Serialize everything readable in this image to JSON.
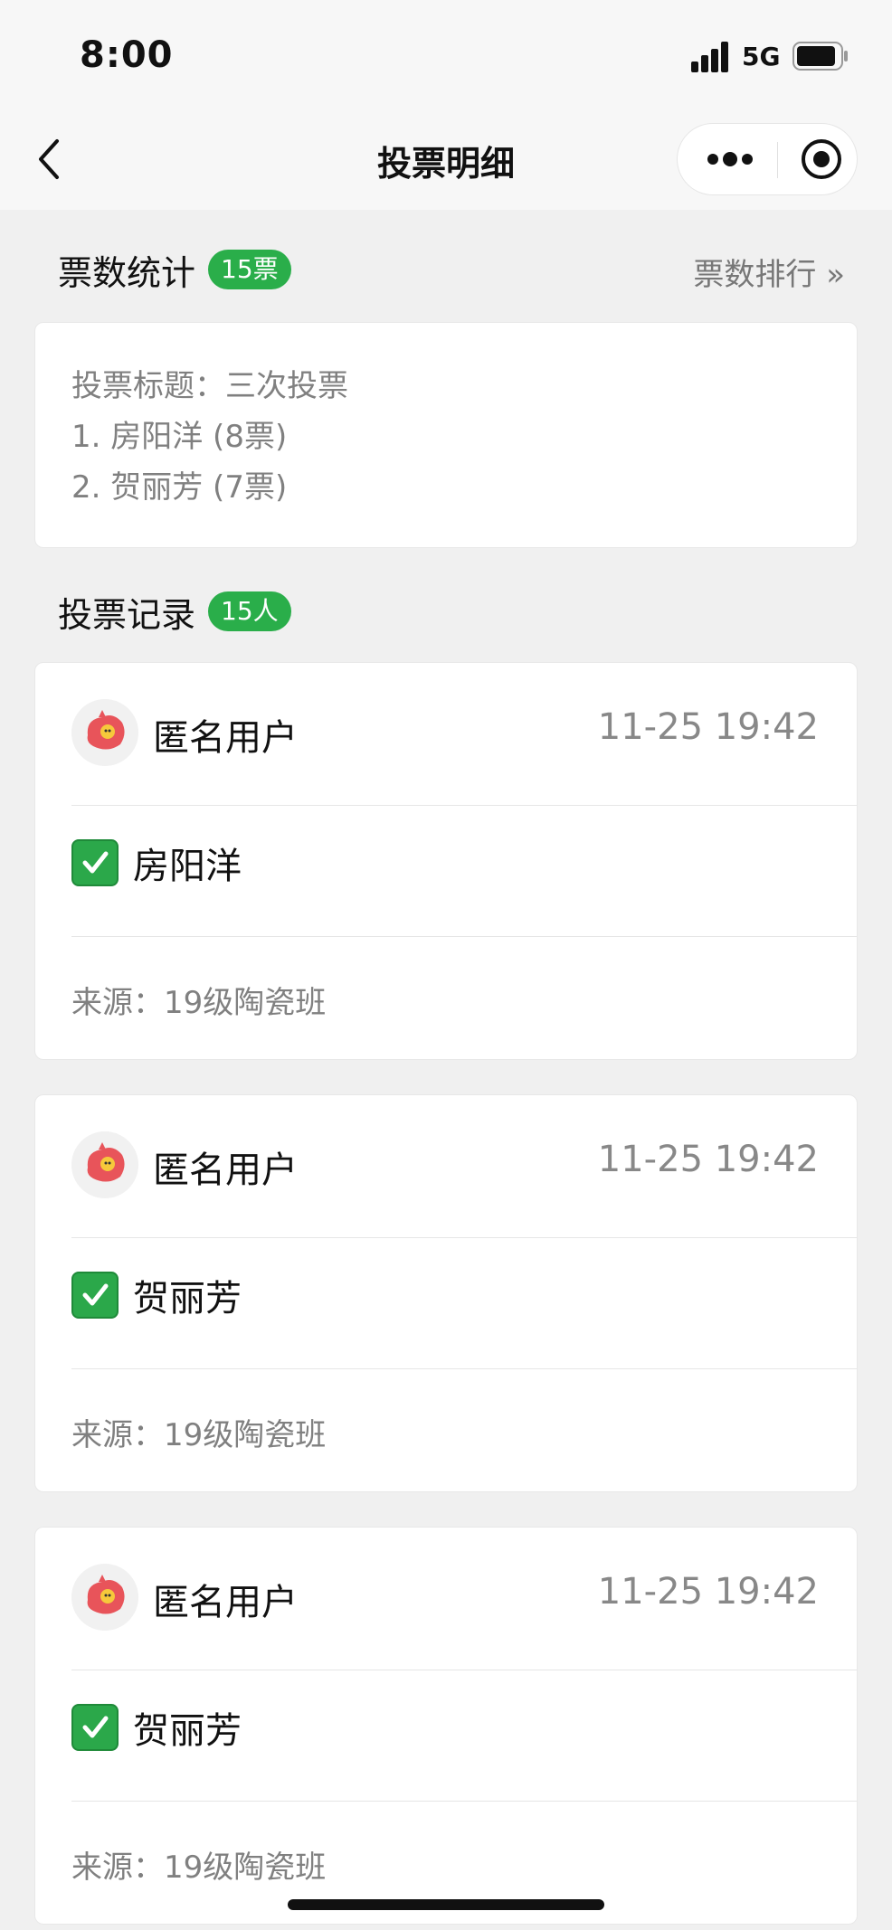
{
  "status_bar": {
    "time": "8:00",
    "network": "5G"
  },
  "nav": {
    "title": "投票明细"
  },
  "stats": {
    "section_title": "票数统计",
    "badge": "15票",
    "rank_link": "票数排行 »",
    "lines": [
      "投票标题：三次投票",
      "1. 房阳洋 (8票)",
      "2. 贺丽芳 (7票)"
    ]
  },
  "records": {
    "section_title": "投票记录",
    "badge": "15人",
    "items": [
      {
        "user": "匿名用户",
        "time": "11-25 19:42",
        "choice": "房阳洋",
        "source": "来源：19级陶瓷班"
      },
      {
        "user": "匿名用户",
        "time": "11-25 19:42",
        "choice": "贺丽芳",
        "source": "来源：19级陶瓷班"
      },
      {
        "user": "匿名用户",
        "time": "11-25 19:42",
        "choice": "贺丽芳",
        "source": "来源：19级陶瓷班"
      }
    ]
  },
  "colors": {
    "accent_green": "#2aae4a",
    "background": "#f0f0f0"
  },
  "icons": [
    "back-icon",
    "more-icon",
    "target-icon",
    "check-icon",
    "avatar-pig-icon",
    "signal-icon",
    "battery-icon"
  ]
}
